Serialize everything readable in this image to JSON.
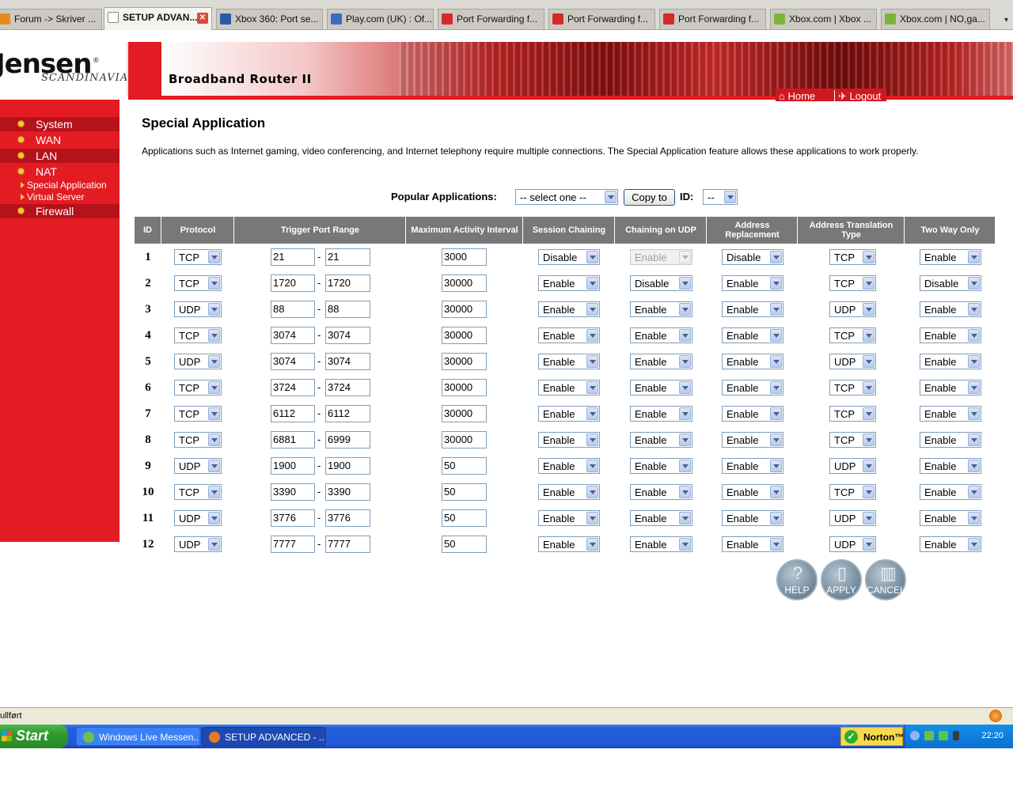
{
  "browser": {
    "tabs": [
      {
        "label": "Forum -> Skriver ...",
        "icon": "forum-icon",
        "active": false
      },
      {
        "label": "SETUP ADVAN...",
        "icon": "page-icon",
        "active": true
      },
      {
        "label": "Xbox 360: Port se...",
        "icon": "m-icon",
        "active": false
      },
      {
        "label": "Play.com (UK) : Of...",
        "icon": "play-icon",
        "active": false
      },
      {
        "label": "Port Forwarding f...",
        "icon": "pf-icon",
        "active": false
      },
      {
        "label": "Port Forwarding f...",
        "icon": "pf-icon",
        "active": false
      },
      {
        "label": "Port Forwarding f...",
        "icon": "pf-icon",
        "active": false
      },
      {
        "label": "Xbox.com | Xbox ...",
        "icon": "xbox-icon",
        "active": false
      },
      {
        "label": "Xbox.com | NO,ga...",
        "icon": "xbox-icon",
        "active": false
      }
    ],
    "tab_close": "✕",
    "tab_overflow": "▾",
    "status_text": "ullført"
  },
  "header": {
    "logo": "Jensen",
    "logo_reg": "®",
    "logo_sub": "SCANDINAVIA",
    "title": "Broadband Router II",
    "home": "Home",
    "logout": "Logout"
  },
  "sidebar": {
    "items": [
      {
        "label": "System"
      },
      {
        "label": "WAN"
      },
      {
        "label": "LAN"
      },
      {
        "label": "NAT"
      },
      {
        "label": "Firewall"
      }
    ],
    "subitems": [
      {
        "label": "Special Application"
      },
      {
        "label": "Virtual Server"
      }
    ]
  },
  "main": {
    "title": "Special Application",
    "description": "Applications such as Internet gaming, video conferencing, and Internet telephony require multiple connections. The Special Application feature allows these applications to work properly.",
    "popular_label": "Popular Applications:",
    "popular_select": "-- select one --",
    "copy_button": "Copy to",
    "id_label": "ID:",
    "id_select": "--",
    "columns": [
      "ID",
      "Protocol",
      "Trigger Port Range",
      "Maximum Activity Interval",
      "Session Chaining",
      "Chaining on UDP",
      "Address Replacement",
      "Address Translation Type",
      "Two Way Only"
    ],
    "rows": [
      {
        "id": "1",
        "protocol": "TCP",
        "start": "21",
        "end": "21",
        "interval": "3000",
        "session": "Disable",
        "udp": "Enable",
        "udp_disabled": true,
        "addr": "Disable",
        "trans": "TCP",
        "twoway": "Enable"
      },
      {
        "id": "2",
        "protocol": "TCP",
        "start": "1720",
        "end": "1720",
        "interval": "30000",
        "session": "Enable",
        "udp": "Disable",
        "udp_disabled": false,
        "addr": "Enable",
        "trans": "TCP",
        "twoway": "Disable"
      },
      {
        "id": "3",
        "protocol": "UDP",
        "start": "88",
        "end": "88",
        "interval": "30000",
        "session": "Enable",
        "udp": "Enable",
        "udp_disabled": false,
        "addr": "Enable",
        "trans": "UDP",
        "twoway": "Enable"
      },
      {
        "id": "4",
        "protocol": "TCP",
        "start": "3074",
        "end": "3074",
        "interval": "30000",
        "session": "Enable",
        "udp": "Enable",
        "udp_disabled": false,
        "addr": "Enable",
        "trans": "TCP",
        "twoway": "Enable"
      },
      {
        "id": "5",
        "protocol": "UDP",
        "start": "3074",
        "end": "3074",
        "interval": "30000",
        "session": "Enable",
        "udp": "Enable",
        "udp_disabled": false,
        "addr": "Enable",
        "trans": "UDP",
        "twoway": "Enable"
      },
      {
        "id": "6",
        "protocol": "TCP",
        "start": "3724",
        "end": "3724",
        "interval": "30000",
        "session": "Enable",
        "udp": "Enable",
        "udp_disabled": false,
        "addr": "Enable",
        "trans": "TCP",
        "twoway": "Enable"
      },
      {
        "id": "7",
        "protocol": "TCP",
        "start": "6112",
        "end": "6112",
        "interval": "30000",
        "session": "Enable",
        "udp": "Enable",
        "udp_disabled": false,
        "addr": "Enable",
        "trans": "TCP",
        "twoway": "Enable"
      },
      {
        "id": "8",
        "protocol": "TCP",
        "start": "6881",
        "end": "6999",
        "interval": "30000",
        "session": "Enable",
        "udp": "Enable",
        "udp_disabled": false,
        "addr": "Enable",
        "trans": "TCP",
        "twoway": "Enable"
      },
      {
        "id": "9",
        "protocol": "UDP",
        "start": "1900",
        "end": "1900",
        "interval": "50",
        "session": "Enable",
        "udp": "Enable",
        "udp_disabled": false,
        "addr": "Enable",
        "trans": "UDP",
        "twoway": "Enable"
      },
      {
        "id": "10",
        "protocol": "TCP",
        "start": "3390",
        "end": "3390",
        "interval": "50",
        "session": "Enable",
        "udp": "Enable",
        "udp_disabled": false,
        "addr": "Enable",
        "trans": "TCP",
        "twoway": "Enable"
      },
      {
        "id": "11",
        "protocol": "UDP",
        "start": "3776",
        "end": "3776",
        "interval": "50",
        "session": "Enable",
        "udp": "Enable",
        "udp_disabled": false,
        "addr": "Enable",
        "trans": "UDP",
        "twoway": "Enable"
      },
      {
        "id": "12",
        "protocol": "UDP",
        "start": "7777",
        "end": "7777",
        "interval": "50",
        "session": "Enable",
        "udp": "Enable",
        "udp_disabled": false,
        "addr": "Enable",
        "trans": "UDP",
        "twoway": "Enable"
      }
    ],
    "buttons": {
      "help": "HELP",
      "apply": "APPLY",
      "cancel": "CANCEL"
    }
  },
  "taskbar": {
    "start": "Start",
    "tasks": [
      {
        "label": "Windows Live Messen...",
        "active": false
      },
      {
        "label": "SETUP ADVANCED - ...",
        "active": true
      }
    ],
    "norton": "Norton™",
    "clock": "22:20"
  },
  "colors": {
    "brand_red": "#e31b23",
    "table_header": "#787878",
    "taskbar_blue": "#245edc"
  }
}
